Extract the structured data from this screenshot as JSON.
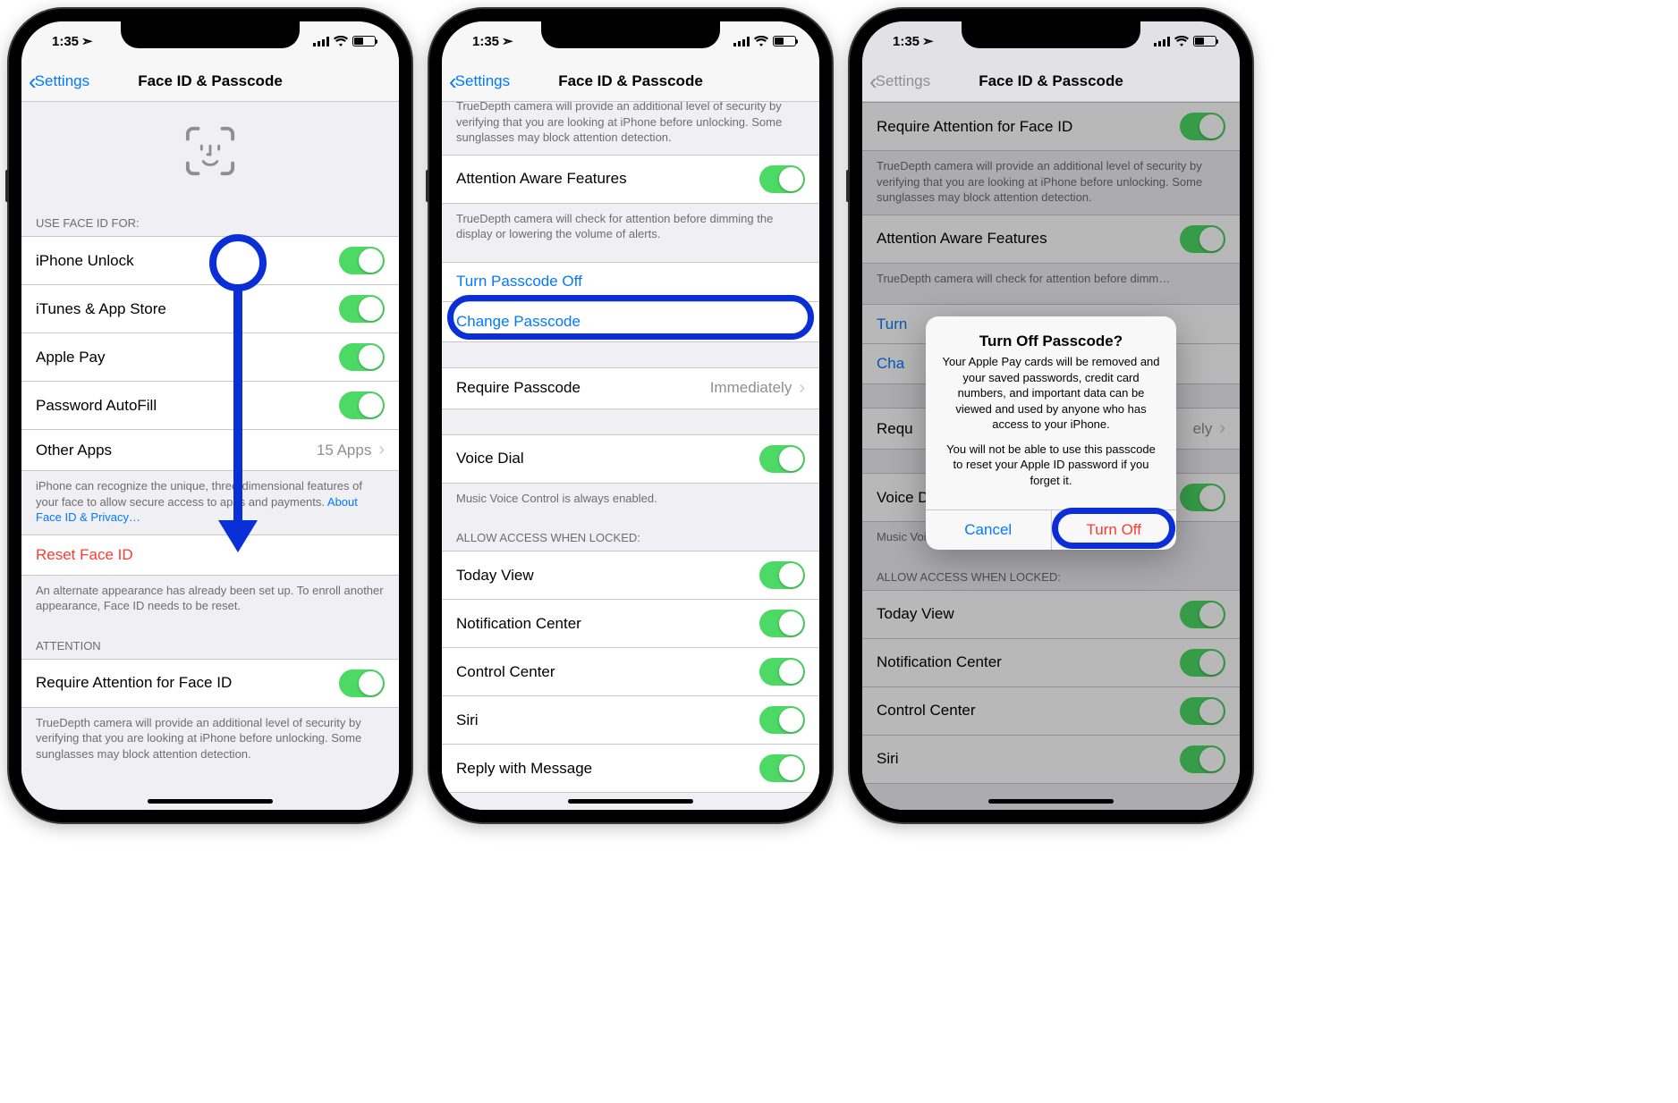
{
  "status": {
    "time": "1:35",
    "location_arrow": "↗"
  },
  "nav": {
    "back": "Settings",
    "title": "Face ID & Passcode"
  },
  "screen1": {
    "section_use_header": "USE FACE ID FOR:",
    "items": {
      "iphone_unlock": "iPhone Unlock",
      "itunes": "iTunes & App Store",
      "apple_pay": "Apple Pay",
      "pw_autofill": "Password AutoFill",
      "other_apps": "Other Apps",
      "other_apps_detail": "15 Apps"
    },
    "use_footer_1": "iPhone can recognize the unique, three-dimensional features of your face to allow secure access to apps and payments. ",
    "use_footer_link": "About Face ID & Privacy…",
    "reset": "Reset Face ID",
    "reset_footer": "An alternate appearance has already been set up. To enroll another appearance, Face ID needs to be reset.",
    "attention_header": "ATTENTION",
    "require_attention": "Require Attention for Face ID",
    "attention_footer": "TrueDepth camera will provide an additional level of security by verifying that you are looking at iPhone before unlocking. Some sunglasses may block attention detection."
  },
  "screen2": {
    "top_footer": "TrueDepth camera will provide an additional level of security by verifying that you are looking at iPhone before unlocking. Some sunglasses may block attention detection.",
    "attention_aware": "Attention Aware Features",
    "attention_aware_footer": "TrueDepth camera will check for attention before dimming the display or lowering the volume of alerts.",
    "turn_off": "Turn Passcode Off",
    "change": "Change Passcode",
    "require": "Require Passcode",
    "require_detail": "Immediately",
    "voice_dial": "Voice Dial",
    "voice_dial_footer": "Music Voice Control is always enabled.",
    "allow_header": "ALLOW ACCESS WHEN LOCKED:",
    "allow": {
      "today": "Today View",
      "notif": "Notification Center",
      "control": "Control Center",
      "siri": "Siri",
      "reply": "Reply with Message"
    }
  },
  "screen3": {
    "require_attention": "Require Attention for Face ID",
    "attention_footer": "TrueDepth camera will provide an additional level of security by verifying that you are looking at iPhone before unlocking. Some sunglasses may block attention detection.",
    "attention_aware": "Attention Aware Features",
    "attention_aware_footer": "TrueDepth camera will check for attention before dimm…",
    "turn_off_abbrev": "Turn",
    "change_abbrev": "Cha",
    "require": "Requ",
    "require_detail_abbrev": "ely",
    "voice_dial": "Voice Dial",
    "voice_dial_footer": "Music Voice Control is always enabled.",
    "allow_header": "ALLOW ACCESS WHEN LOCKED:",
    "allow": {
      "today": "Today View",
      "notif": "Notification Center",
      "control": "Control Center",
      "siri": "Siri"
    },
    "alert": {
      "title": "Turn Off Passcode?",
      "msg1": "Your Apple Pay cards will be removed and your saved passwords, credit card numbers, and important data can be viewed and used by anyone who has access to your iPhone.",
      "msg2": "You will not be able to use this passcode to reset your Apple ID password if you forget it.",
      "cancel": "Cancel",
      "confirm": "Turn Off"
    }
  }
}
